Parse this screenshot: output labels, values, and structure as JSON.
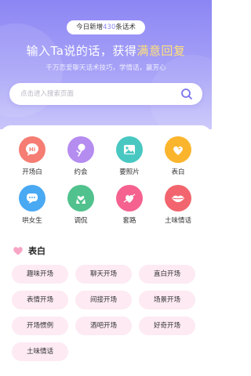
{
  "header": {
    "banner_prefix": "今日新增",
    "banner_count": "430",
    "banner_suffix": "条话术",
    "headline_main": "输入Ta说的话，获得",
    "headline_highlight": "满意回复",
    "subline": "千万恋爱聊天话术技巧，学情话，赢芳心"
  },
  "search": {
    "placeholder": "点击进入搜索页面",
    "icon": "search-icon"
  },
  "categories": [
    {
      "label": "开场白",
      "icon": "hi-bubble-icon",
      "color": "#f57d73"
    },
    {
      "label": "约会",
      "icon": "rose-icon",
      "color": "#b58cf0"
    },
    {
      "label": "要照片",
      "icon": "photo-icon",
      "color": "#49c8c2"
    },
    {
      "label": "表白",
      "icon": "hearts-icon",
      "color": "#fbb52d"
    },
    {
      "label": "哄女生",
      "icon": "speech-bubble-icon",
      "color": "#4aa9f3"
    },
    {
      "label": "调侃",
      "icon": "heart-hands-icon",
      "color": "#51c28d"
    },
    {
      "label": "套路",
      "icon": "cupid-heart-icon",
      "color": "#f5628f"
    },
    {
      "label": "土味情话",
      "icon": "lips-icon",
      "color": "#f2656e"
    }
  ],
  "section": {
    "title": "表白",
    "icon": "heart-icon",
    "accent": "#f7a5c5"
  },
  "tags": [
    "趣味开场",
    "聊天开场",
    "直白开场",
    "表情开场",
    "间接开场",
    "场景开场",
    "开场惯例",
    "酒吧开场",
    "好奇开场",
    "土味情话"
  ],
  "colors": {
    "header_top": "#8c86f4",
    "tag_bg": "#fdeaf3"
  }
}
